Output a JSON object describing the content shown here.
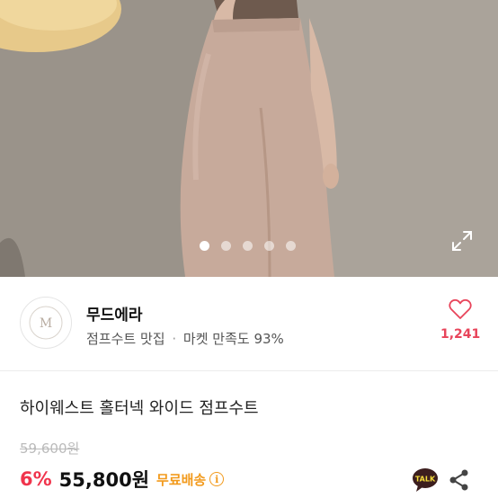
{
  "carousel": {
    "total_slides": 5,
    "active_index": 0
  },
  "seller": {
    "name": "무드에라",
    "tagline": "점프수트 맛집",
    "separator": "·",
    "satisfaction": "마켓 만족도 93%",
    "logo_text": "M"
  },
  "like": {
    "count": "1,241"
  },
  "product": {
    "title": "하이웨스트 홀터넥 와이드 점프수트",
    "original_price": "59,600원",
    "discount": "6%",
    "price": "55,800원",
    "shipping": "무료배송",
    "info_icon_glyph": "i"
  },
  "actions": {
    "talk_label": "TALK"
  },
  "colors": {
    "discount": "#f0344c",
    "shipping": "#f29a1c",
    "like": "#e8445a"
  },
  "icons": [
    "expand-icon",
    "heart-icon",
    "info-icon",
    "kakao-talk-icon",
    "share-icon"
  ]
}
